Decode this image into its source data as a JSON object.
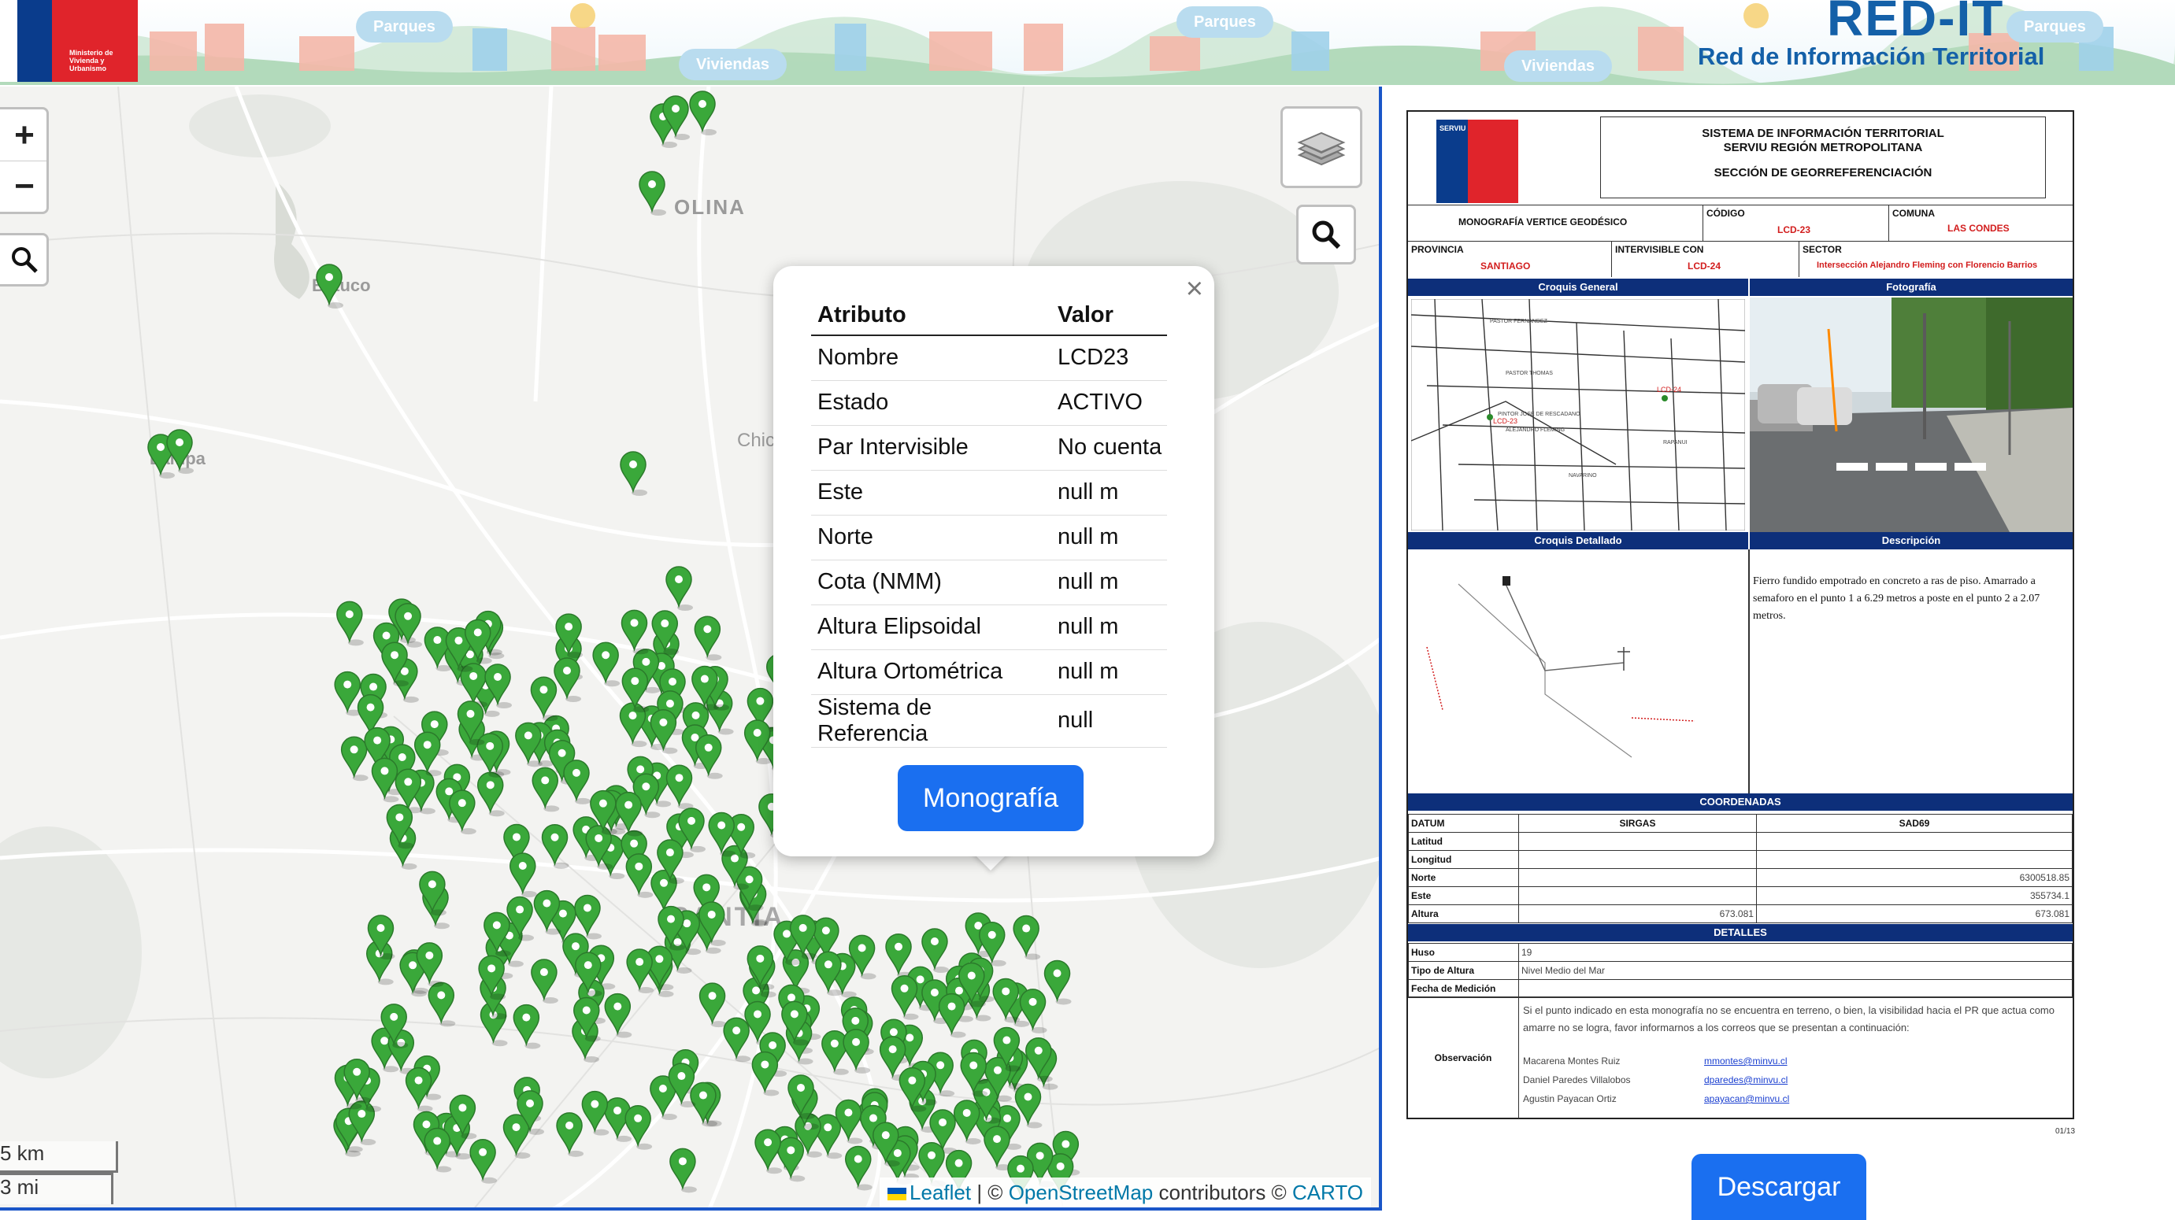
{
  "banner": {
    "gov_logo_text": "Ministerio de Vivienda y Urbanismo",
    "title": "RED-IT",
    "subtitle": "Red de Información Territorial",
    "clouds": [
      "Parques",
      "Viviendas",
      "Parques",
      "Viviendas",
      "Parques"
    ]
  },
  "map": {
    "place_labels": [
      "OLINA",
      "Batuco",
      "Lampa",
      "Chic",
      "SANTIA"
    ],
    "scale_km": "5 km",
    "scale_mi": "3 mi",
    "attribution": {
      "leaflet": "Leaflet",
      "sep1": " | © ",
      "osm": "OpenStreetMap",
      "contrib": " contributors © ",
      "carto": "CARTO"
    },
    "marker_color": "#3aa83a"
  },
  "popup": {
    "header_attr": "Atributo",
    "header_val": "Valor",
    "close": "×",
    "rows": [
      {
        "attr": "Nombre",
        "val": "LCD23"
      },
      {
        "attr": "Estado",
        "val": "ACTIVO"
      },
      {
        "attr": "Par Intervisible",
        "val": "No cuenta"
      },
      {
        "attr": "Este",
        "val": "null m"
      },
      {
        "attr": "Norte",
        "val": "null m"
      },
      {
        "attr": "Cota (NMM)",
        "val": "null m"
      },
      {
        "attr": "Altura Elipsoidal",
        "val": "null m"
      },
      {
        "attr": "Altura Ortométrica",
        "val": "null m"
      },
      {
        "attr": "Sistema de Referencia",
        "val": "null"
      }
    ],
    "button": "Monografía"
  },
  "doc": {
    "serviu_text": "SERVIU",
    "head_line1": "SISTEMA DE INFORMACIÓN TERRITORIAL",
    "head_line2": "SERVIU REGIÓN METROPOLITANA",
    "head_line3": "SECCIÓN DE GEORREFERENCIACIÓN",
    "monografia_label": "MONOGRAFÍA VERTICE GEODÉSICO",
    "codigo_label": "CÓDIGO",
    "codigo_val": "LCD-23",
    "comuna_label": "COMUNA",
    "comuna_val": "LAS CONDES",
    "provincia_label": "PROVINCIA",
    "provincia_val": "SANTIAGO",
    "intervisible_label": "INTERVISIBLE CON",
    "intervisible_val": "LCD-24",
    "sector_label": "SECTOR",
    "sector_val": "Intersección Alejandro Fleming con Florencio Barrios",
    "croquis_general": "Croquis General",
    "fotografia": "Fotografía",
    "croquis_detallado": "Croquis Detallado",
    "descripcion": "Descripción",
    "descripcion_text": "Fierro fundido empotrado en concreto a ras de piso. Amarrado a semaforo en el punto 1 a 6.29 metros a poste en el punto 2 a 2.07 metros.",
    "sketch_labels": [
      "LCD-24",
      "LCD-23"
    ],
    "coordenadas": "COORDENADAS",
    "coord_headers": [
      "DATUM",
      "SIRGAS",
      "SAD69"
    ],
    "coord_rows": [
      {
        "label": "Latitud",
        "sirgas": "",
        "sad69": ""
      },
      {
        "label": "Longitud",
        "sirgas": "",
        "sad69": ""
      },
      {
        "label": "Norte",
        "sirgas": "",
        "sad69": "6300518.85"
      },
      {
        "label": "Este",
        "sirgas": "",
        "sad69": "355734.1"
      },
      {
        "label": "Altura",
        "sirgas": "673.081",
        "sad69": "673.081"
      }
    ],
    "detalles": "DETALLES",
    "det_rows": [
      {
        "label": "Huso",
        "val": "19"
      },
      {
        "label": "Tipo de Altura",
        "val": "Nivel Medio del Mar"
      },
      {
        "label": "Fecha de Medición",
        "val": ""
      }
    ],
    "observacion_label": "Observación",
    "observacion_text": "Si el punto indicado en esta monografía no se encuentra en terreno, o bien, la visibilidad hacia el PR que actua como amarre no se logra, favor informarnos a los correos que se presentan a continuación:",
    "contacts": [
      {
        "name": "Macarena Montes Ruiz",
        "email": "mmontes@minvu.cl"
      },
      {
        "name": "Daniel Paredes Villalobos",
        "email": "dparedes@minvu.cl"
      },
      {
        "name": "Agustin Payacan Ortiz",
        "email": "apayacan@minvu.cl"
      }
    ],
    "page_num": "01/13"
  },
  "descargar": "Descargar"
}
